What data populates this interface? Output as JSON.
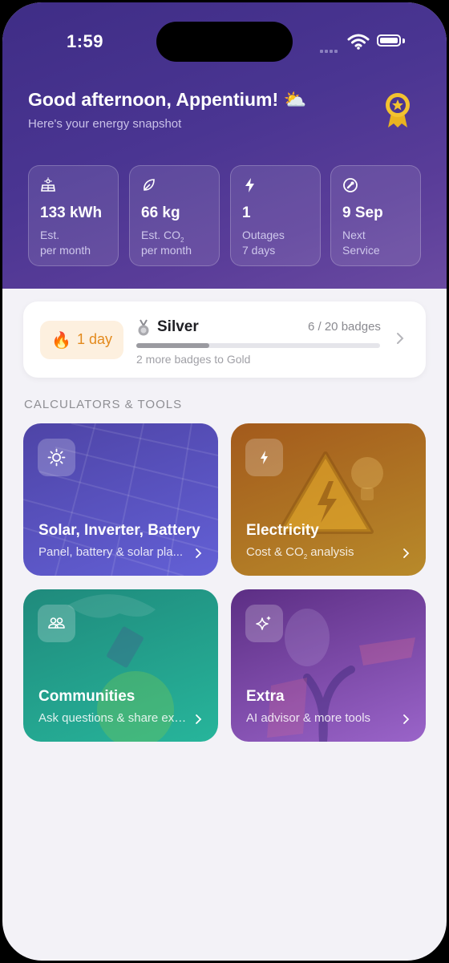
{
  "status": {
    "time": "1:59"
  },
  "header": {
    "greeting": "Good afternoon, Appentium! ⛅",
    "subtitle": "Here's your energy snapshot"
  },
  "stats": [
    {
      "icon": "solar-panel-icon",
      "value": "133 kWh",
      "label1": "Est.",
      "label2": "per month"
    },
    {
      "icon": "leaf-icon",
      "value": "66 kg",
      "label1": "Est. CO",
      "label1_sub": "2",
      "label2": "per month"
    },
    {
      "icon": "bolt-icon",
      "value": "1",
      "label1": "Outages",
      "label2": "7 days"
    },
    {
      "icon": "wrench-icon",
      "value": "9 Sep",
      "label1": "Next",
      "label2": "Service"
    }
  ],
  "streak": {
    "flame": "🔥",
    "days": "1 day",
    "tier": "Silver",
    "progress_text": "6 / 20 badges",
    "progress": 0.3,
    "next_text": "2 more badges to Gold"
  },
  "section_title": "CALCULATORS & TOOLS",
  "cards": [
    {
      "icon": "sun-icon",
      "title": "Solar, Inverter, Battery",
      "subtitle": "Panel, battery & solar pla...",
      "color_top": "#4e44a6",
      "color_bottom": "#6360d6"
    },
    {
      "icon": "bolt-icon",
      "title": "Electricity",
      "subtitle": "Cost & CO",
      "subtitle_sub": "2",
      "subtitle_end": " analysis",
      "color_top": "#a35a1c",
      "color_bottom": "#b88a2a"
    },
    {
      "icon": "users-icon",
      "title": "Communities",
      "subtitle": "Ask questions & share exp...",
      "color_top": "#1f8a7c",
      "color_bottom": "#27b59b"
    },
    {
      "icon": "sparkles-icon",
      "title": "Extra",
      "subtitle": "AI advisor & more tools",
      "color_top": "#5c2e84",
      "color_bottom": "#9a64c9"
    }
  ]
}
